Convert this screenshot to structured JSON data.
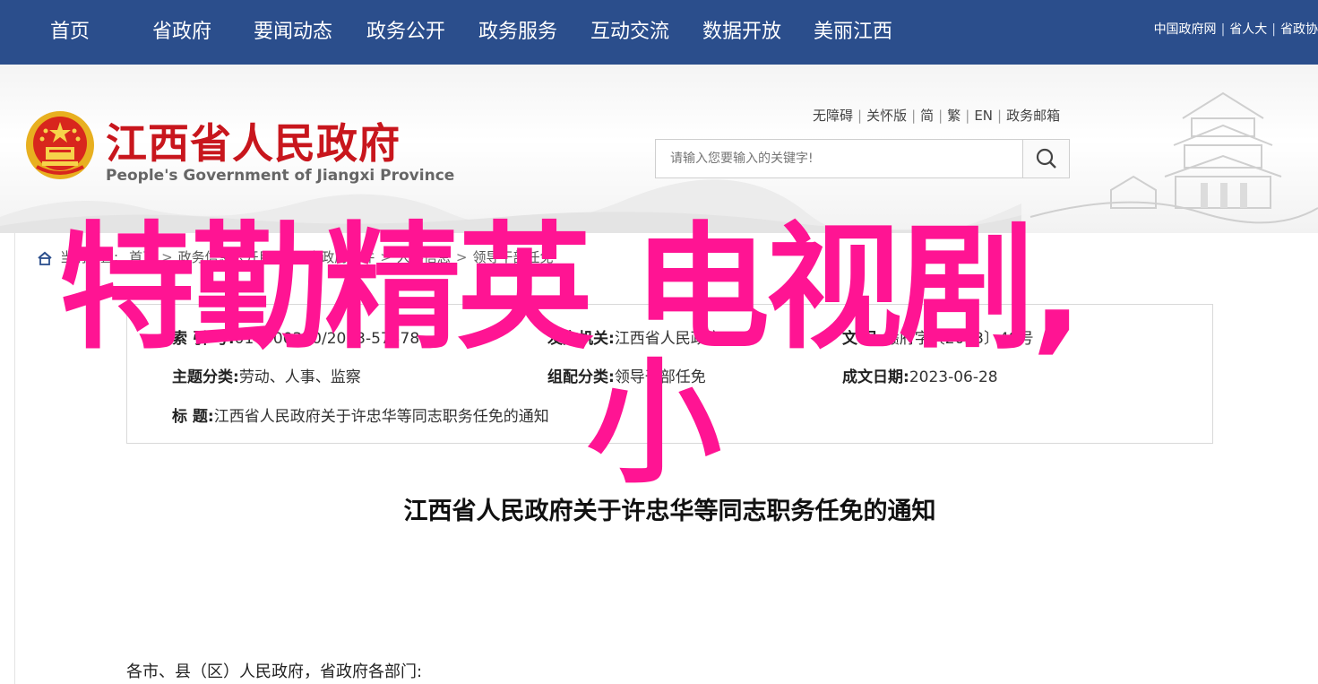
{
  "topnav": {
    "items": [
      "首页",
      "省政府",
      "要闻动态",
      "政务公开",
      "政务服务",
      "互动交流",
      "数据开放",
      "美丽江西"
    ],
    "right_links": [
      "中国政府网",
      "省人大",
      "省政协"
    ]
  },
  "header": {
    "title": "江西省人民政府",
    "subtitle": "People's Government of Jiangxi Province",
    "util_links": [
      "无障碍",
      "关怀版",
      "简",
      "繁",
      "EN",
      "政务邮箱"
    ],
    "search_placeholder": "请输入您要输入的关键字!"
  },
  "breadcrumb": {
    "items": [
      "当前位置:",
      "首页",
      "政务信息公开目录",
      "省政府文件",
      "人事信息",
      "领导干部任免"
    ]
  },
  "doc_info": {
    "index_label": "索 引 号:",
    "index_value": "014500310/2023-57378",
    "issuer_label": "发文机关:",
    "issuer_value": "江西省人民政府",
    "docno_label": "文 号:",
    "docno_value": "赣府字〔2023〕48号",
    "topic_label": "主题分类:",
    "topic_value": "劳动、人事、监察",
    "org_label": "组配分类:",
    "org_value": "领导干部任免",
    "date_label": "成文日期:",
    "date_value": "2023-06-28",
    "title_label": "标 题:",
    "title_value": "江西省人民政府关于许忠华等同志职务任免的通知"
  },
  "document": {
    "title": "江西省人民政府关于许忠华等同志职务任免的通知",
    "greeting": "各市、县（区）人民政府，省政府各部门:"
  },
  "overlay": {
    "line1": "特勤精英 电视剧,",
    "line2": "小"
  },
  "colors": {
    "nav_bg": "#2b4e8c",
    "title_red": "#c8161d",
    "overlay_pink": "#ff1493"
  }
}
